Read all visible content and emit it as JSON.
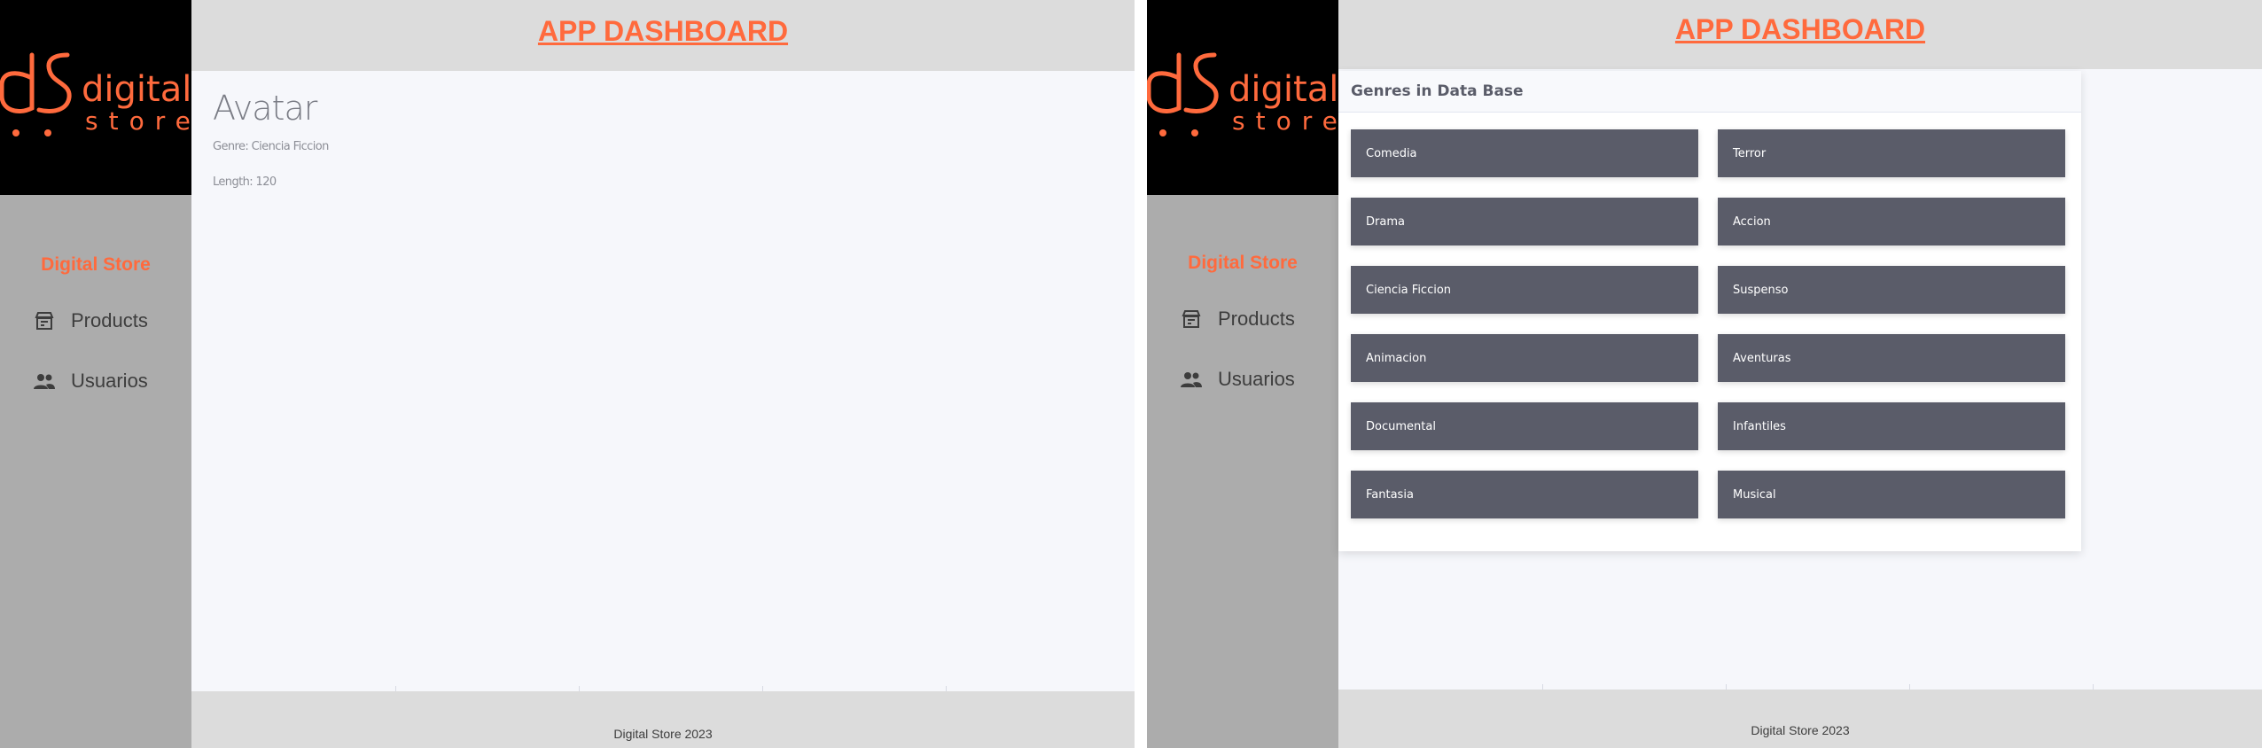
{
  "brand": {
    "logo_top": "digital",
    "logo_bottom": "store",
    "name": "Digital Store"
  },
  "colors": {
    "accent": "#ff6a3d",
    "sidebar": "#acacac",
    "header": "#dcdcdc",
    "content": "#f6f7fb",
    "genre_tile": "#5a5c69"
  },
  "nav": {
    "items": [
      {
        "label": "Products",
        "icon": "storefront-icon"
      },
      {
        "label": "Usuarios",
        "icon": "users-icon"
      }
    ]
  },
  "header": {
    "title": "APP DASHBOARD"
  },
  "footer": {
    "text": "Digital Store 2023"
  },
  "product": {
    "title": "Avatar",
    "genre_line": "Genre: Ciencia Ficcion",
    "length_line": "Length: 120"
  },
  "genres": {
    "title": "Genres in Data Base",
    "items": [
      "Comedia",
      "Terror",
      "Drama",
      "Accion",
      "Ciencia Ficcion",
      "Suspenso",
      "Animacion",
      "Aventuras",
      "Documental",
      "Infantiles",
      "Fantasia",
      "Musical"
    ]
  }
}
